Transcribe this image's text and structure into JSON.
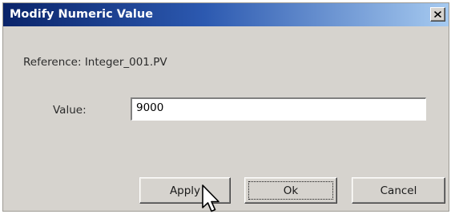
{
  "window": {
    "title": "Modify Numeric Value",
    "close_icon": "close-icon"
  },
  "reference": {
    "text": "Reference: Integer_001.PV"
  },
  "value_field": {
    "label": "Value:",
    "value": "9000"
  },
  "buttons": {
    "apply": "Apply",
    "ok": "Ok",
    "cancel": "Cancel"
  },
  "cursor": {
    "icon": "mouse-pointer-icon",
    "hovering": "apply-button"
  },
  "colors": {
    "titlebar_start": "#0a246a",
    "titlebar_end": "#a6caf0",
    "dialog_face": "#d6d3ce"
  }
}
